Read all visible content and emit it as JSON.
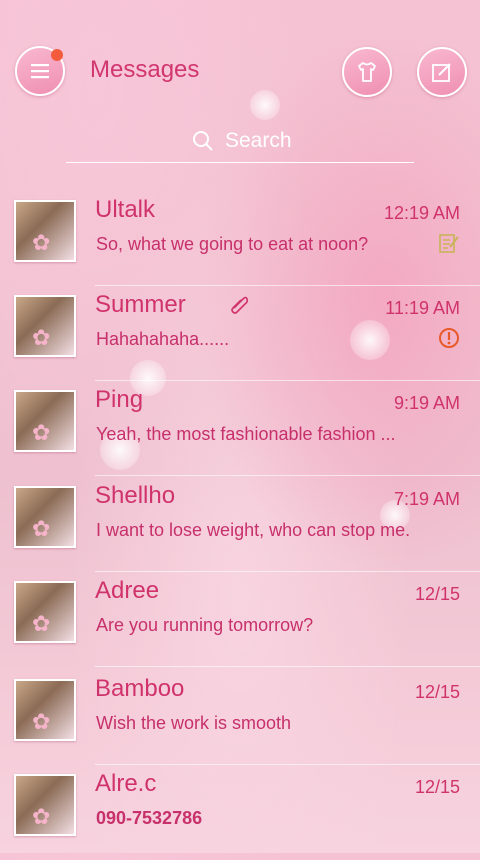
{
  "header": {
    "title": "Messages",
    "icons": [
      "menu-icon",
      "theme-shirt-icon",
      "compose-icon"
    ],
    "notification_dot_color": "#f25c3c"
  },
  "search": {
    "placeholder": "Search"
  },
  "colors": {
    "accent": "#d0336b",
    "background": "#f5c2d3"
  },
  "conversations": [
    {
      "name": "Ultalk",
      "time": "12:19 AM",
      "preview": "So, what we going to eat at noon?",
      "status_icon": "draft-icon"
    },
    {
      "name": "Summer",
      "time": "11:19 AM",
      "preview": "Hahahahaha......",
      "status_icon": "error-icon",
      "attachment_icon": "paperclip-icon"
    },
    {
      "name": "Ping",
      "time": "9:19 AM",
      "preview": "Yeah, the most fashionable fashion ..."
    },
    {
      "name": "Shellho",
      "time": "7:19 AM",
      "preview": "I want to lose weight, who can stop me."
    },
    {
      "name": "Adree",
      "time": "12/15",
      "preview": "Are you running tomorrow?"
    },
    {
      "name": "Bamboo",
      "time": "12/15",
      "preview": "Wish the work is smooth"
    },
    {
      "name": "Alre.c",
      "time": "12/15",
      "preview": "090-7532786"
    }
  ]
}
